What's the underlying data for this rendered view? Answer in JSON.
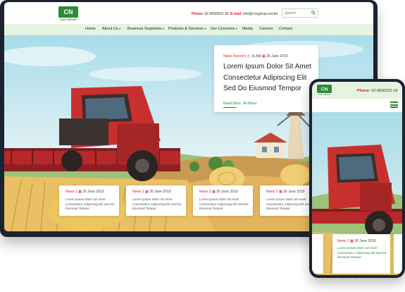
{
  "brand": {
    "logo_mark": "CN",
    "logo_sub": "CNC GROUP"
  },
  "header": {
    "phone_label": "Phone:",
    "phone_value": "02-9830915-18",
    "email_label": "E-mail:",
    "email_value": "info@cncgroup.net.bd",
    "search_placeholder": "Search"
  },
  "nav": {
    "items": [
      {
        "label": "Home"
      },
      {
        "label": "About Us",
        "dropdown": true
      },
      {
        "label": "Business Segments",
        "dropdown": true
      },
      {
        "label": "Products & Services",
        "dropdown": true
      },
      {
        "label": "Our Concerns",
        "dropdown": true
      },
      {
        "label": "Media"
      },
      {
        "label": "Careers"
      },
      {
        "label": "Contact"
      }
    ],
    "caret": "▾"
  },
  "featured": {
    "tag": "News Recent",
    "separator": "|",
    "time": "10 AM",
    "date": "26 June 2019",
    "title": "Lorem Ipsum Dolor Sit Amet Consectetur Adipiscing Elit Sed Do Eiusmod Tempor",
    "read_more": "Read More",
    "all_news": "All News"
  },
  "news_cards": [
    {
      "tag": "News",
      "num": "1",
      "date": "26 June 2019",
      "text": "Lorem Ipsum Dolor Sit Amet Consectetur Adipiscing Elit Sed Do Eiusmod Tempor"
    },
    {
      "tag": "News",
      "num": "1",
      "date": "26 June 2019",
      "text": "Lorem Ipsum Dolor Sit Amet Consectetur Adipiscing Elit Sed Do Eiusmod Tempor"
    },
    {
      "tag": "News",
      "num": "3",
      "date": "26 June 2019",
      "text": "Lorem Ipsum Dolor Sit Amet Consectetur Adipiscing Elit Sed Do Eiusmod Tempor"
    },
    {
      "tag": "News",
      "num": "3",
      "date": "26 June 2019",
      "text": "Lorem Ipsum Dolor Sit Amet Consectetur Adipiscing Elit Sed Do Eiusmod Tempor"
    }
  ],
  "mobile": {
    "phone_label": "Phone:",
    "phone_value": "02-9830915-18",
    "card": {
      "tag": "News",
      "num": "1",
      "date": "26 June 2019",
      "text": "Lorem Ipsum Dolor Sit Amet Consectetur Adipiscing Elit Sed Do Eiusmod Tempor"
    }
  },
  "colors": {
    "brand_green": "#2f8a3a",
    "accent_red": "#e02020",
    "nav_bg": "#e5f3e1",
    "device_frame": "#1c2330"
  },
  "icons": {
    "search": "search-icon",
    "calendar": "calendar-icon",
    "clock": "clock-icon",
    "menu": "hamburger-menu-icon"
  }
}
